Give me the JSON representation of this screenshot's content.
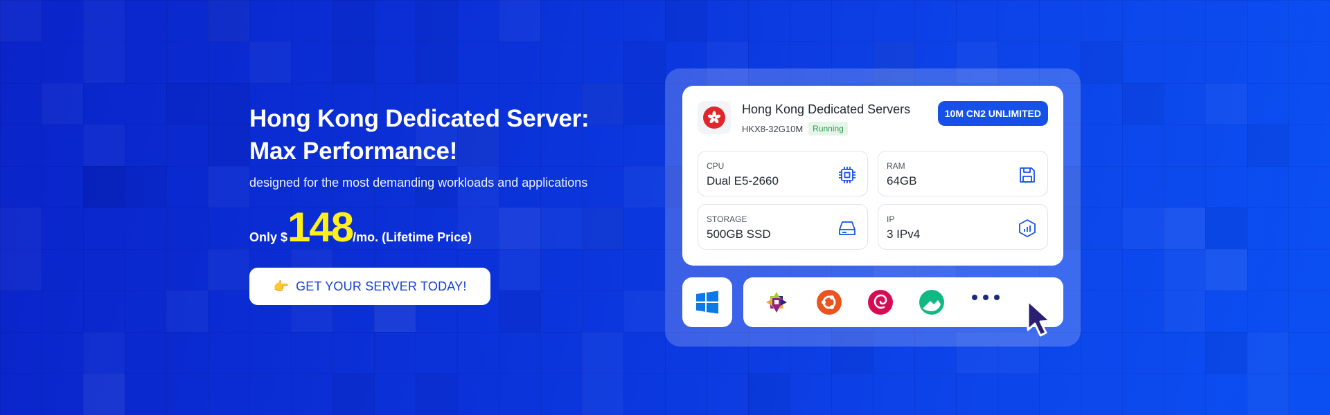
{
  "promo": {
    "headline_line1": "Hong Kong Dedicated Server:",
    "headline_line2": "Max Performance!",
    "subline": "designed for the most demanding workloads and applications",
    "price_prefix": "Only $",
    "price_value": "148",
    "price_suffix": "/mo. (Lifetime Price)",
    "cta_emoji": "👉",
    "cta_label": "GET YOUR SERVER TODAY!"
  },
  "card": {
    "title": "Hong Kong Dedicated Servers",
    "model": "HKX8-32G10M",
    "status": "Running",
    "badge": "10M CN2 UNLIMITED",
    "flag_icon": "hong-kong-flag-icon",
    "specs": [
      {
        "label": "CPU",
        "value": "Dual E5-2660",
        "icon": "cpu-chip-icon"
      },
      {
        "label": "RAM",
        "value": "64GB",
        "icon": "floppy-disk-icon"
      },
      {
        "label": "STORAGE",
        "value": "500GB SSD",
        "icon": "hard-drive-icon"
      },
      {
        "label": "IP",
        "value": "3 IPv4",
        "icon": "network-hexagon-icon"
      }
    ]
  },
  "os": {
    "primary": "windows-icon",
    "options": [
      "centos-icon",
      "ubuntu-icon",
      "debian-icon",
      "rocky-linux-icon",
      "more-icon"
    ]
  },
  "colors": {
    "accent": "#1550e8",
    "price_highlight": "#ffef1a",
    "status_green": "#2f9b4d",
    "flag_red": "#e0262a",
    "ubuntu_orange": "#e95420",
    "debian_red": "#d70a53",
    "rocky_green": "#10b981",
    "windows_blue": "#0a7ae8"
  }
}
